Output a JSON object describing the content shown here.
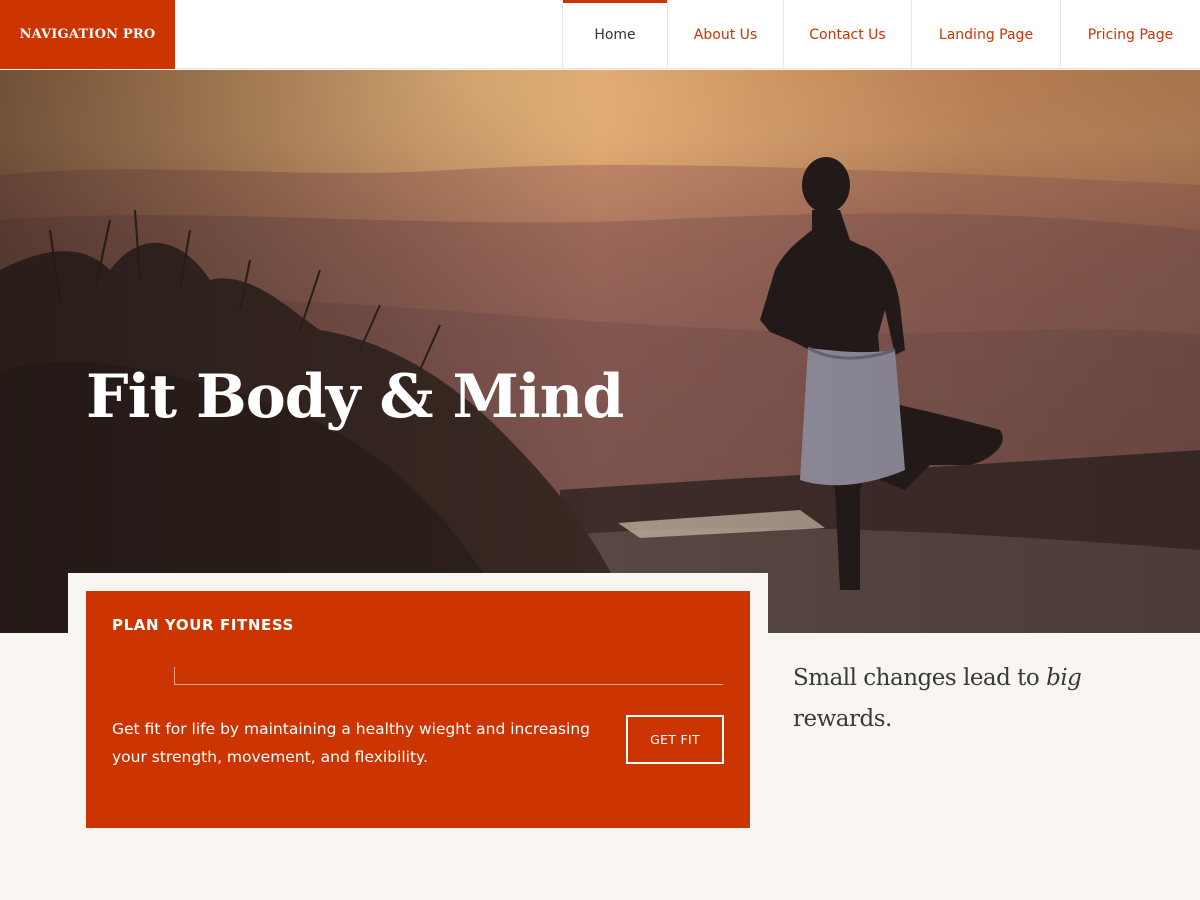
{
  "header": {
    "logo": "NAVIGATION PRO",
    "nav": [
      {
        "label": "Home",
        "active": true
      },
      {
        "label": "About Us",
        "active": false
      },
      {
        "label": "Contact Us",
        "active": false
      },
      {
        "label": "Landing Page",
        "active": false
      },
      {
        "label": "Pricing Page",
        "active": false
      }
    ]
  },
  "hero": {
    "title": "Fit Body & Mind"
  },
  "card": {
    "heading": "PLAN YOUR FITNESS",
    "text": "Get fit for life by maintaining a healthy wieght and increasing your strength, movement, and flexibility.",
    "button": "GET FIT"
  },
  "quote": {
    "before": "Small changes lead to ",
    "emphasis": "big",
    "after": " rewards."
  },
  "colors": {
    "accent": "#cc3402",
    "background": "#f9f6f2"
  }
}
